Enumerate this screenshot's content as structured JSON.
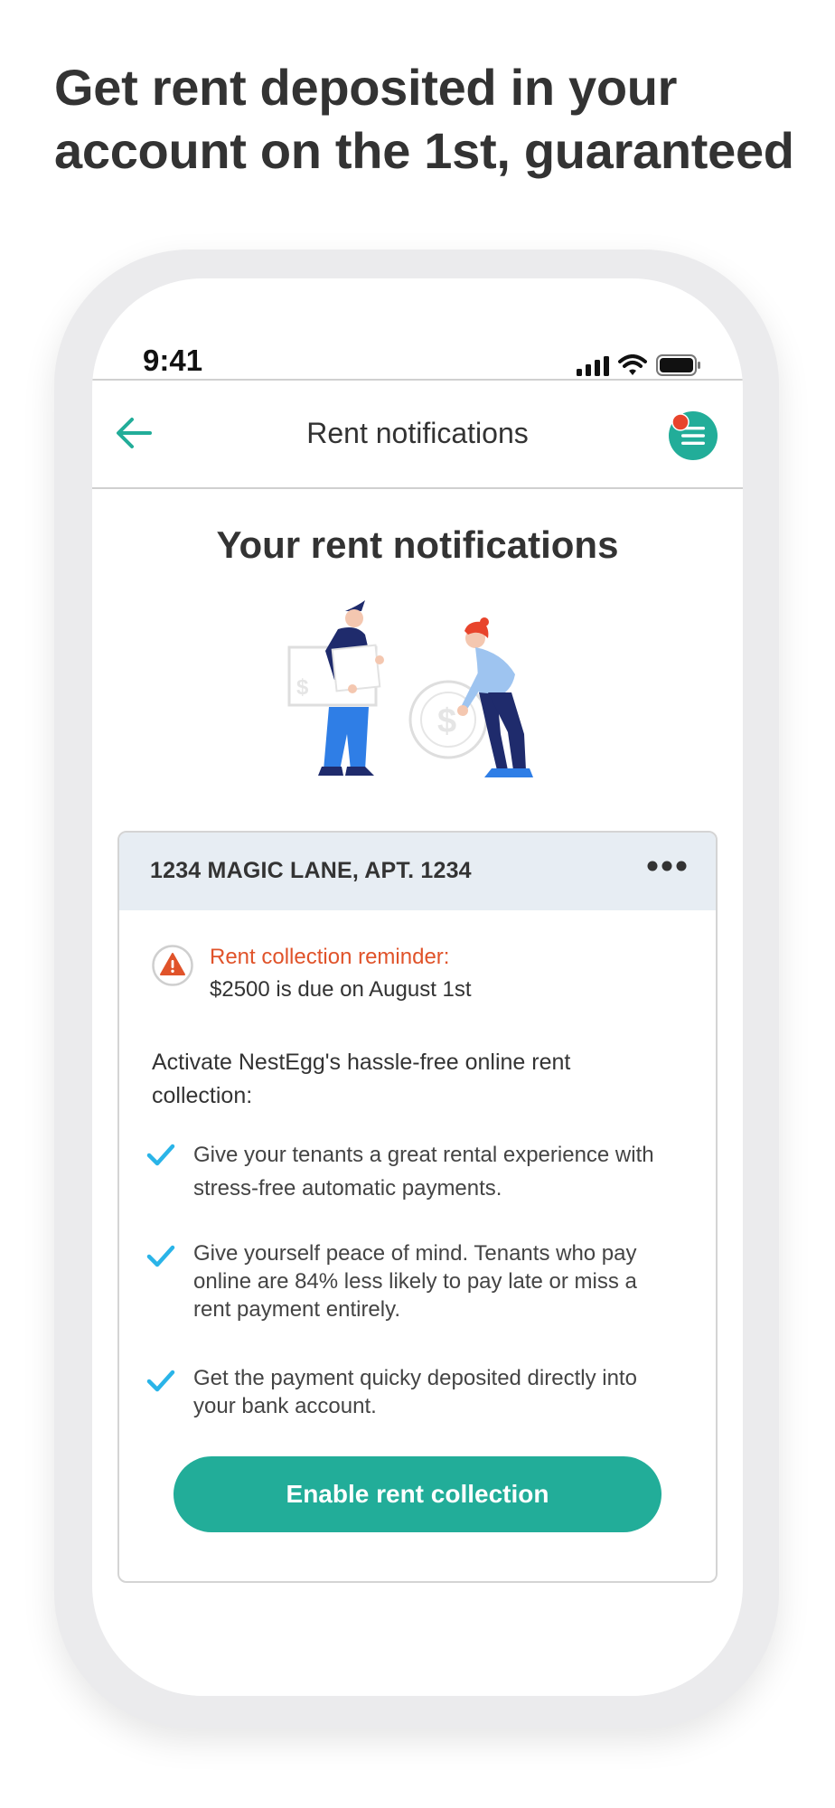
{
  "headline": {
    "line1": "Get rent deposited in your",
    "line2": "account on the 1st, guaranteed"
  },
  "status_bar": {
    "time": "9:41",
    "icons": [
      "cellular-signal-icon",
      "wifi-icon",
      "battery-icon"
    ]
  },
  "app_bar": {
    "title": "Rent notifications",
    "back_icon": "arrow-left-icon",
    "menu_icon": "menu-icon",
    "menu_has_notification_dot": true
  },
  "page": {
    "heading": "Your rent notifications"
  },
  "property_card": {
    "address": "1234 MAGIC LANE, APT. 1234",
    "more_icon": "more-horizontal-icon",
    "reminder": {
      "title": "Rent collection reminder:",
      "detail": "$2500 is due on August 1st"
    },
    "activate_text": "Activate NestEgg's hassle-free online rent collection:",
    "benefits": [
      {
        "text": "Give your tenants a great rental experience with stress-free automatic payments."
      },
      {
        "text": "Give yourself peace of mind. Tenants who pay online are 84% less likely to pay late or miss a rent payment entirely."
      },
      {
        "text": "Get the payment quicky deposited directly into your bank account."
      }
    ],
    "cta_label": "Enable rent collection"
  },
  "colors": {
    "brand_teal": "#22ad99",
    "warning": "#e0532a",
    "check": "#2ab4e8",
    "card_header": "#e7edf3"
  }
}
